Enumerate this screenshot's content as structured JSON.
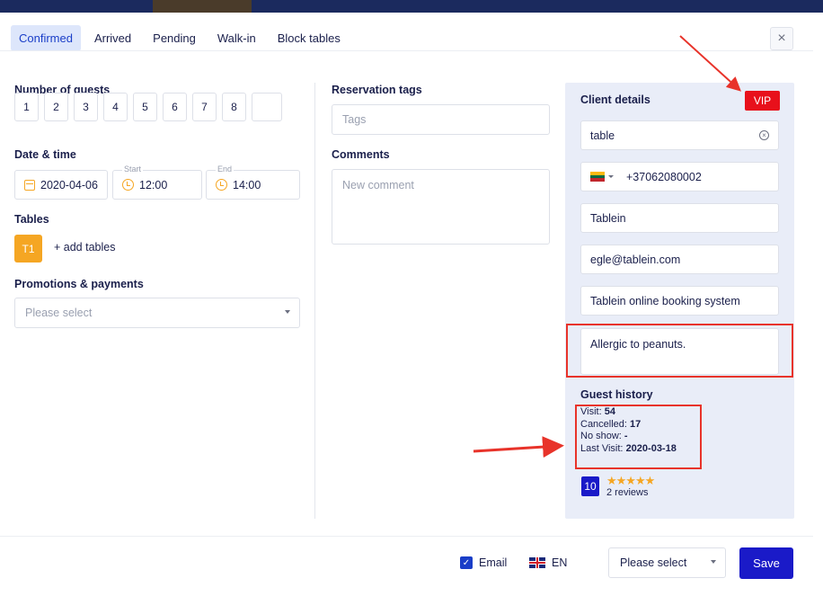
{
  "header": {
    "tabs": [
      {
        "label": "Confirmed",
        "active": true
      },
      {
        "label": "Arrived",
        "active": false
      },
      {
        "label": "Pending",
        "active": false
      },
      {
        "label": "Walk-in",
        "active": false
      },
      {
        "label": "Block tables",
        "active": false
      }
    ],
    "close_icon": "close-icon"
  },
  "guests": {
    "label": "Number of guests",
    "options": [
      "1",
      "2",
      "3",
      "4",
      "5",
      "6",
      "7",
      "8"
    ]
  },
  "datetime": {
    "label": "Date & time",
    "date": "2020-04-06",
    "start_label": "Start",
    "start": "12:00",
    "end_label": "End",
    "end": "14:00"
  },
  "tables": {
    "label": "Tables",
    "selected": "T1",
    "add_label": "+ add tables"
  },
  "promotions": {
    "label": "Promotions & payments",
    "placeholder": "Please select"
  },
  "reservation": {
    "tags_label": "Reservation tags",
    "tags_placeholder": "Tags",
    "comments_label": "Comments",
    "comments_placeholder": "New comment"
  },
  "client": {
    "title": "Client details",
    "vip": "VIP",
    "search_value": "table",
    "phone": "+37062080002",
    "name": "Tablein",
    "email": "egle@tablein.com",
    "company": "Tablein online booking system",
    "note": "Allergic to peanuts."
  },
  "history": {
    "title": "Guest history",
    "visit_label": "Visit:",
    "visit": "54",
    "cancelled_label": "Cancelled:",
    "cancelled": "17",
    "noshow_label": "No show:",
    "noshow": "-",
    "last_label": "Last Visit:",
    "last": "2020-03-18",
    "rating": "10",
    "stars": "★★★★★",
    "reviews": "2 reviews"
  },
  "footer": {
    "email_label": "Email",
    "lang": "EN",
    "select_placeholder": "Please select",
    "save": "Save"
  },
  "colors": {
    "accent": "#1a3ec8",
    "orange": "#f5a623",
    "vip_red": "#e8101b",
    "annotation_red": "#e8332a"
  }
}
